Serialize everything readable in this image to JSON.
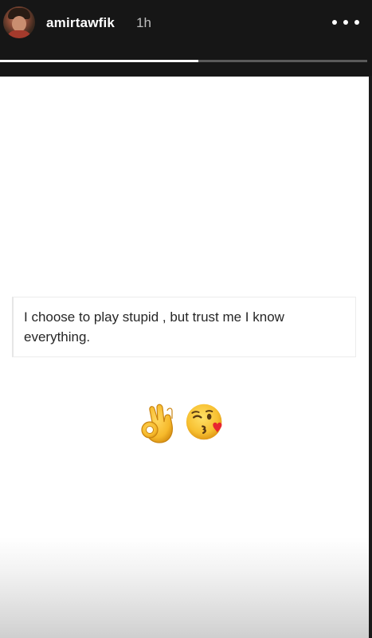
{
  "header": {
    "username": "amirtawfik",
    "time": "1h",
    "more_icon": "more-horizontal-icon",
    "progress_fraction": 0.54
  },
  "story": {
    "caption": "I choose to play stupid , but trust me I know everything.",
    "emojis": [
      "ok-hand",
      "face-blowing-kiss"
    ]
  },
  "colors": {
    "header_bg": "#161616",
    "story_bg": "#ffffff",
    "progress_track": "#5a5a5a",
    "progress_fill": "#ffffff",
    "caption_text": "#262626"
  }
}
